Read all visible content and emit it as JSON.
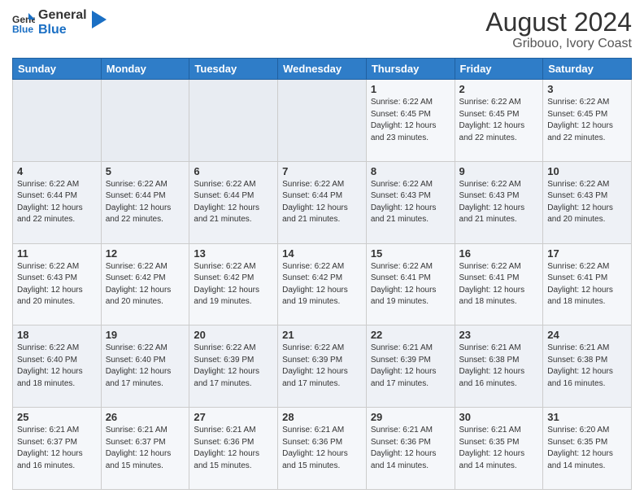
{
  "header": {
    "logo_line1": "General",
    "logo_line2": "Blue",
    "main_title": "August 2024",
    "sub_title": "Gribouo, Ivory Coast"
  },
  "weekdays": [
    "Sunday",
    "Monday",
    "Tuesday",
    "Wednesday",
    "Thursday",
    "Friday",
    "Saturday"
  ],
  "rows": [
    [
      {
        "day": "",
        "info": ""
      },
      {
        "day": "",
        "info": ""
      },
      {
        "day": "",
        "info": ""
      },
      {
        "day": "",
        "info": ""
      },
      {
        "day": "1",
        "info": "Sunrise: 6:22 AM\nSunset: 6:45 PM\nDaylight: 12 hours\nand 23 minutes."
      },
      {
        "day": "2",
        "info": "Sunrise: 6:22 AM\nSunset: 6:45 PM\nDaylight: 12 hours\nand 22 minutes."
      },
      {
        "day": "3",
        "info": "Sunrise: 6:22 AM\nSunset: 6:45 PM\nDaylight: 12 hours\nand 22 minutes."
      }
    ],
    [
      {
        "day": "4",
        "info": "Sunrise: 6:22 AM\nSunset: 6:44 PM\nDaylight: 12 hours\nand 22 minutes."
      },
      {
        "day": "5",
        "info": "Sunrise: 6:22 AM\nSunset: 6:44 PM\nDaylight: 12 hours\nand 22 minutes."
      },
      {
        "day": "6",
        "info": "Sunrise: 6:22 AM\nSunset: 6:44 PM\nDaylight: 12 hours\nand 21 minutes."
      },
      {
        "day": "7",
        "info": "Sunrise: 6:22 AM\nSunset: 6:44 PM\nDaylight: 12 hours\nand 21 minutes."
      },
      {
        "day": "8",
        "info": "Sunrise: 6:22 AM\nSunset: 6:43 PM\nDaylight: 12 hours\nand 21 minutes."
      },
      {
        "day": "9",
        "info": "Sunrise: 6:22 AM\nSunset: 6:43 PM\nDaylight: 12 hours\nand 21 minutes."
      },
      {
        "day": "10",
        "info": "Sunrise: 6:22 AM\nSunset: 6:43 PM\nDaylight: 12 hours\nand 20 minutes."
      }
    ],
    [
      {
        "day": "11",
        "info": "Sunrise: 6:22 AM\nSunset: 6:43 PM\nDaylight: 12 hours\nand 20 minutes."
      },
      {
        "day": "12",
        "info": "Sunrise: 6:22 AM\nSunset: 6:42 PM\nDaylight: 12 hours\nand 20 minutes."
      },
      {
        "day": "13",
        "info": "Sunrise: 6:22 AM\nSunset: 6:42 PM\nDaylight: 12 hours\nand 19 minutes."
      },
      {
        "day": "14",
        "info": "Sunrise: 6:22 AM\nSunset: 6:42 PM\nDaylight: 12 hours\nand 19 minutes."
      },
      {
        "day": "15",
        "info": "Sunrise: 6:22 AM\nSunset: 6:41 PM\nDaylight: 12 hours\nand 19 minutes."
      },
      {
        "day": "16",
        "info": "Sunrise: 6:22 AM\nSunset: 6:41 PM\nDaylight: 12 hours\nand 18 minutes."
      },
      {
        "day": "17",
        "info": "Sunrise: 6:22 AM\nSunset: 6:41 PM\nDaylight: 12 hours\nand 18 minutes."
      }
    ],
    [
      {
        "day": "18",
        "info": "Sunrise: 6:22 AM\nSunset: 6:40 PM\nDaylight: 12 hours\nand 18 minutes."
      },
      {
        "day": "19",
        "info": "Sunrise: 6:22 AM\nSunset: 6:40 PM\nDaylight: 12 hours\nand 17 minutes."
      },
      {
        "day": "20",
        "info": "Sunrise: 6:22 AM\nSunset: 6:39 PM\nDaylight: 12 hours\nand 17 minutes."
      },
      {
        "day": "21",
        "info": "Sunrise: 6:22 AM\nSunset: 6:39 PM\nDaylight: 12 hours\nand 17 minutes."
      },
      {
        "day": "22",
        "info": "Sunrise: 6:21 AM\nSunset: 6:39 PM\nDaylight: 12 hours\nand 17 minutes."
      },
      {
        "day": "23",
        "info": "Sunrise: 6:21 AM\nSunset: 6:38 PM\nDaylight: 12 hours\nand 16 minutes."
      },
      {
        "day": "24",
        "info": "Sunrise: 6:21 AM\nSunset: 6:38 PM\nDaylight: 12 hours\nand 16 minutes."
      }
    ],
    [
      {
        "day": "25",
        "info": "Sunrise: 6:21 AM\nSunset: 6:37 PM\nDaylight: 12 hours\nand 16 minutes."
      },
      {
        "day": "26",
        "info": "Sunrise: 6:21 AM\nSunset: 6:37 PM\nDaylight: 12 hours\nand 15 minutes."
      },
      {
        "day": "27",
        "info": "Sunrise: 6:21 AM\nSunset: 6:36 PM\nDaylight: 12 hours\nand 15 minutes."
      },
      {
        "day": "28",
        "info": "Sunrise: 6:21 AM\nSunset: 6:36 PM\nDaylight: 12 hours\nand 15 minutes."
      },
      {
        "day": "29",
        "info": "Sunrise: 6:21 AM\nSunset: 6:36 PM\nDaylight: 12 hours\nand 14 minutes."
      },
      {
        "day": "30",
        "info": "Sunrise: 6:21 AM\nSunset: 6:35 PM\nDaylight: 12 hours\nand 14 minutes."
      },
      {
        "day": "31",
        "info": "Sunrise: 6:20 AM\nSunset: 6:35 PM\nDaylight: 12 hours\nand 14 minutes."
      }
    ]
  ]
}
